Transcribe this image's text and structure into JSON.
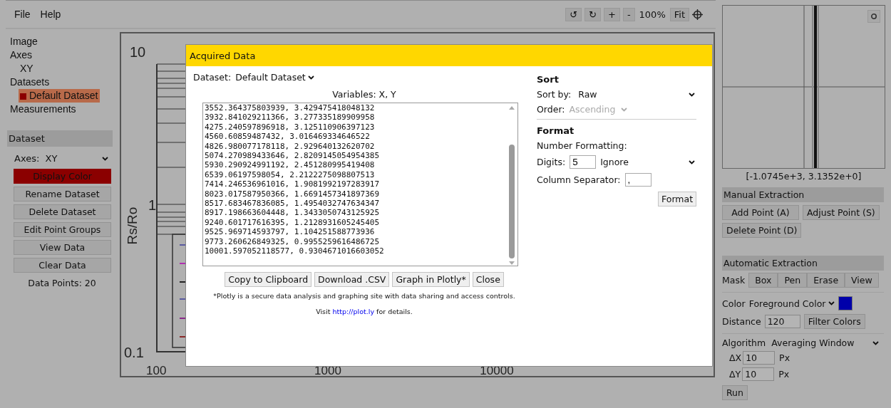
{
  "menu": [
    "File",
    "Help"
  ],
  "toolbar": {
    "buttons": [
      "↺",
      "↻",
      "+",
      "-"
    ],
    "zoom": "100%",
    "fit": "Fit"
  },
  "sidebar": {
    "tree": [
      {
        "label": "Image",
        "selected": false
      },
      {
        "label": "Axes",
        "selected": false,
        "children": [
          {
            "label": "XY",
            "selected": false
          }
        ]
      },
      {
        "label": "Datasets",
        "selected": false,
        "children": [
          {
            "label": "Default Dataset",
            "selected": true,
            "color": "#8b0000"
          }
        ]
      },
      {
        "label": "Measurements",
        "selected": false
      }
    ],
    "dataset_panel": {
      "title": "Dataset",
      "axes_label": "Axes:",
      "axes_value": "XY",
      "display_color": "Display Color",
      "buttons": [
        "Rename Dataset",
        "Delete Dataset",
        "Edit Point Groups",
        "View Data",
        "Clear Data"
      ],
      "data_points": "Data Points: 20"
    }
  },
  "plot": {
    "y_axis_title": "Rs/Ro",
    "y_ticks": [
      "10",
      "1",
      "0.1"
    ],
    "x_ticks": [
      "100",
      "1000",
      "10000"
    ]
  },
  "right_panel": {
    "coordinates": "[-1.0745e+3, 3.1352e+0]",
    "manual": {
      "title": "Manual Extraction",
      "buttons": [
        "Add Point (A)",
        "Adjust Point (S)",
        "Delete Point (D)"
      ]
    },
    "automatic": {
      "title": "Automatic Extraction",
      "mask_label": "Mask",
      "mask_buttons": [
        "Box",
        "Pen",
        "Erase",
        "View"
      ],
      "color_label": "Color",
      "color_mode": "Foreground Color",
      "color": "#0000aa",
      "distance_label": "Distance",
      "distance": "120",
      "filter_button": "Filter Colors",
      "algorithm_label": "Algorithm",
      "algorithm": "Averaging Window",
      "params": [
        {
          "label": "ΔX",
          "value": "10",
          "unit": "Px"
        },
        {
          "label": "ΔY",
          "value": "10",
          "unit": "Px"
        }
      ],
      "run_button": "Run"
    }
  },
  "dialog": {
    "title": "Acquired Data",
    "dataset_label": "Dataset:",
    "dataset": "Default Dataset",
    "variables": "Variables: X, Y",
    "rows": [
      "3552.364375803939, 3.429475418048132",
      "3932.841029211366, 3.277335189909958",
      "4275.240597896918, 3.125110906397123",
      "4560.60859487432, 3.016469334646522",
      "4826.980077178118, 2.929640132620702",
      "5074.270989433646, 2.8209145054954385",
      "5930.290924991192, 2.451280995419408",
      "6539.06197598054, 2.2122275098807513",
      "7414.246536961016, 1.9081992197283917",
      "8023.017587950366, 1.6691457341897369",
      "8517.683467836085, 1.4954032747634347",
      "8917.198663604448, 1.3433050743125925",
      "9240.601717616395, 1.2128931605245405",
      "9525.969714593797, 1.104251588773936",
      "9773.260626849325, 0.9955259616486725",
      "10001.597052118577, 0.9304671016603052"
    ],
    "buttons": [
      "Copy to Clipboard",
      "Download .CSV",
      "Graph in Plotly*",
      "Close"
    ],
    "note": "*Plotly is a secure data analysis and graphing site with data sharing and access controls.",
    "visit_before": "Visit",
    "link": "http://plot.ly",
    "visit_after": "for details.",
    "sort": {
      "title": "Sort",
      "sort_by_label": "Sort by:",
      "sort_by": "Raw",
      "order_label": "Order:",
      "order": "Ascending",
      "order_disabled": true
    },
    "format": {
      "title": "Format",
      "number_label": "Number Formatting:",
      "digits_label": "Digits:",
      "digits": "5",
      "digits_mode": "Ignore",
      "separator_label": "Column Separator:",
      "separator": ",",
      "button": "Format"
    }
  }
}
